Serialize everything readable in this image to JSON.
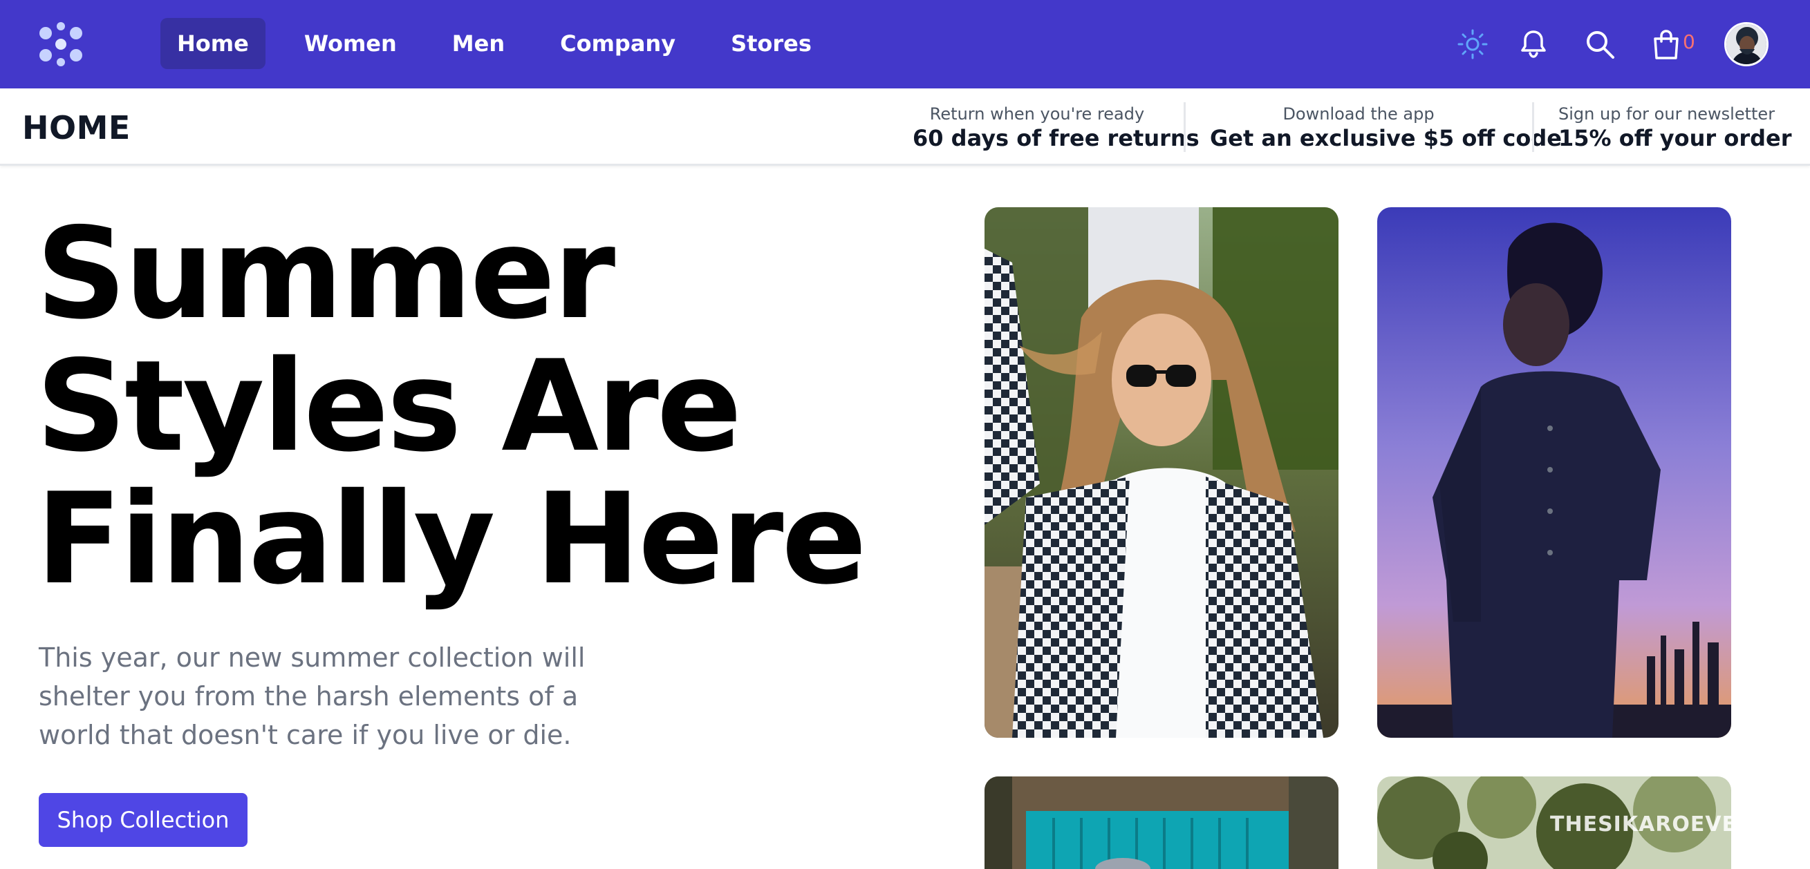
{
  "nav": {
    "logo": "brand-logo",
    "links": [
      {
        "label": "Home",
        "active": true
      },
      {
        "label": "Women",
        "active": false
      },
      {
        "label": "Men",
        "active": false
      },
      {
        "label": "Company",
        "active": false
      },
      {
        "label": "Stores",
        "active": false
      }
    ],
    "icons": [
      "sun-icon",
      "bell-icon",
      "search-icon",
      "shopping-bag-icon"
    ],
    "cart_count": "0",
    "avatar": "user-avatar"
  },
  "subheader": {
    "page_title": "HOME",
    "promos": [
      {
        "small": "Return when you're ready",
        "big": "60 days of free returns"
      },
      {
        "small": "Download the app",
        "big": "Get an exclusive $5 off code"
      },
      {
        "small": "Sign up for our newsletter",
        "big": "15% off your order"
      }
    ]
  },
  "hero": {
    "title_lines": [
      "Summer",
      "Styles Are",
      "Finally Here"
    ],
    "description": "This year, our new summer collection will shelter you from the harsh elements of a world that doesn't care if you live or die.",
    "cta_label": "Shop Collection"
  },
  "watermark": "THESIKAROEVENDRA",
  "colors": {
    "nav_bg": "#4338ca",
    "nav_active": "#3730a3",
    "cta_bg": "#4f46e5",
    "cart_count": "#f87171",
    "sun_icon": "#60a5fa"
  }
}
